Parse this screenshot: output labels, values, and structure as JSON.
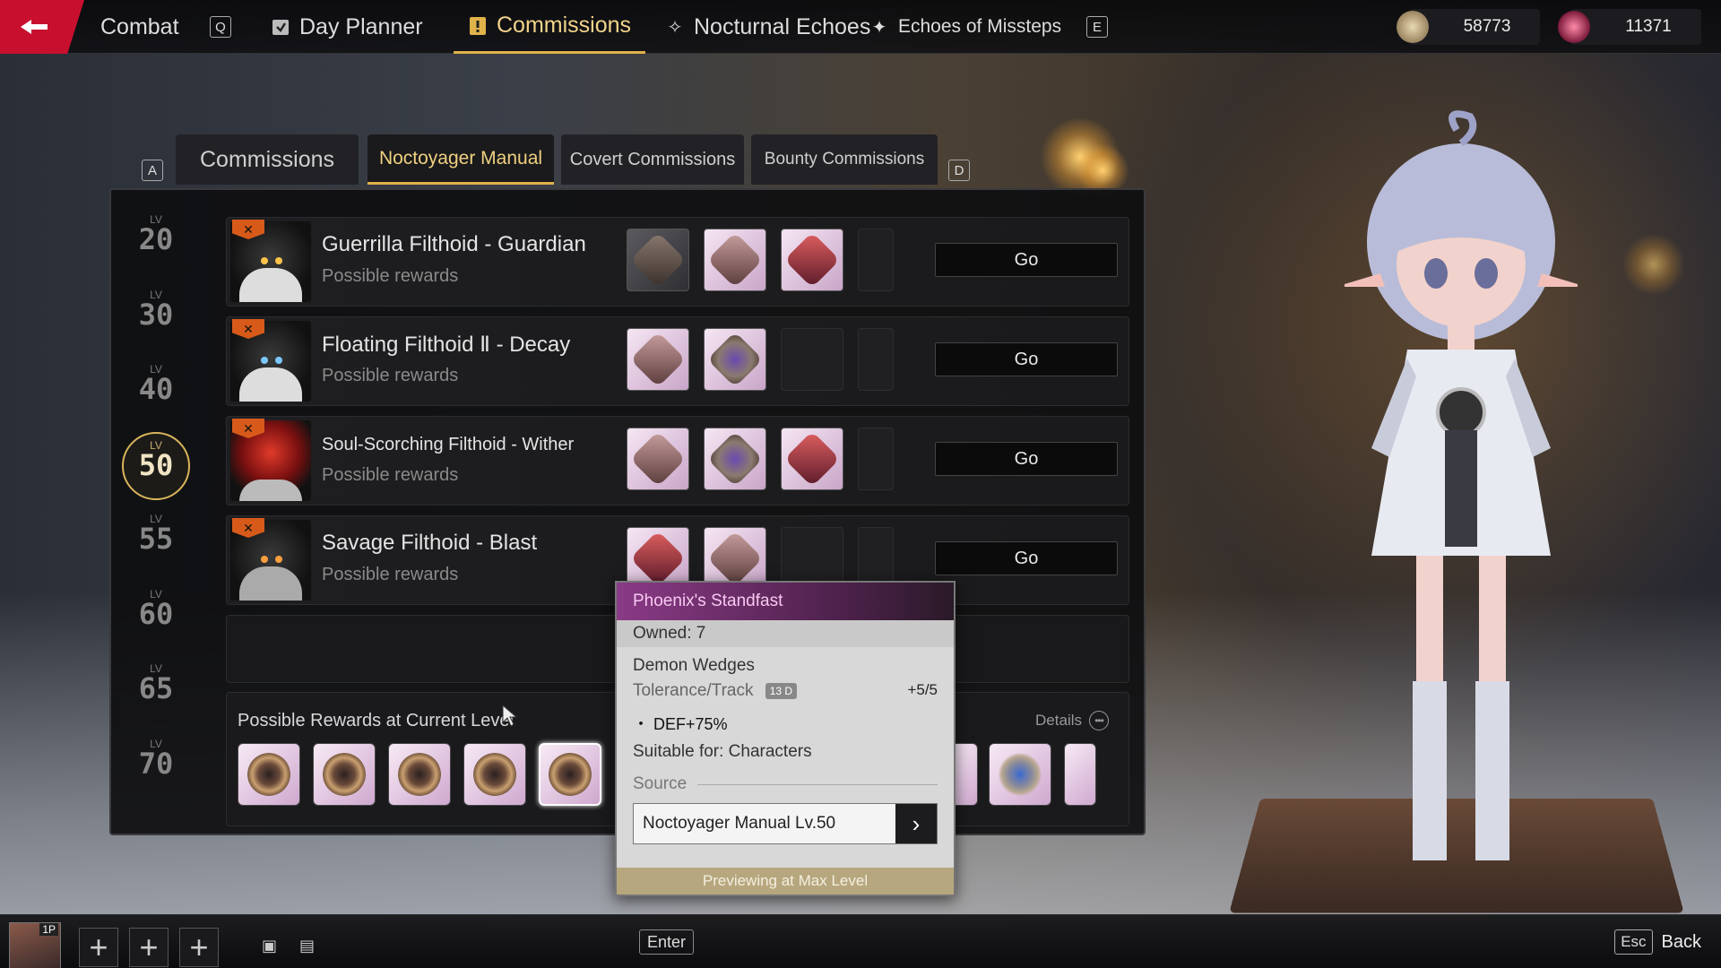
{
  "topbar": {
    "combat": "Combat",
    "key_q": "Q",
    "day_planner": "Day Planner",
    "commissions": "Commissions",
    "nocturnal_echoes": "Nocturnal Echoes",
    "echoes_of_missteps": "Echoes of Missteps",
    "key_e": "E",
    "currency1": "58773",
    "currency2": "11371"
  },
  "tabs": {
    "key_a": "A",
    "commissions": "Commissions",
    "noctoyager": "Noctoyager Manual",
    "covert": "Covert Commissions",
    "bounty": "Bounty Commissions",
    "key_d": "D"
  },
  "levels": [
    {
      "lv": "LV",
      "num": "20"
    },
    {
      "lv": "LV",
      "num": "30"
    },
    {
      "lv": "LV",
      "num": "40"
    },
    {
      "lv": "LV",
      "num": "50"
    },
    {
      "lv": "LV",
      "num": "55"
    },
    {
      "lv": "LV",
      "num": "60"
    },
    {
      "lv": "LV",
      "num": "65"
    },
    {
      "lv": "LV",
      "num": "70"
    }
  ],
  "commissions": [
    {
      "name": "Guerrilla Filthoid - Guardian",
      "sub": "Possible rewards",
      "go": "Go"
    },
    {
      "name": "Floating Filthoid Ⅱ - Decay",
      "sub": "Possible rewards",
      "go": "Go"
    },
    {
      "name": "Soul-Scorching Filthoid - Wither",
      "sub": "Possible rewards",
      "go": "Go"
    },
    {
      "name": "Savage Filthoid - Blast",
      "sub": "Possible rewards",
      "go": "Go"
    }
  ],
  "rewards": {
    "title": "Possible Rewards at Current Level",
    "details": "Details"
  },
  "tooltip": {
    "title": "Phoenix's Standfast",
    "owned": "Owned: 7",
    "type": "Demon Wedges",
    "track_label": "Tolerance/Track",
    "track_tag": "13 D",
    "track_value": "+5/5",
    "stat": "・ DEF+75%",
    "suitable": "Suitable for: Characters",
    "source_label": "Source",
    "source_value": "Noctoyager Manual Lv.50",
    "footer": "Previewing at Max Level"
  },
  "bottom": {
    "player_tag": "1P",
    "enter": "Enter",
    "esc": "Esc",
    "back": "Back"
  }
}
